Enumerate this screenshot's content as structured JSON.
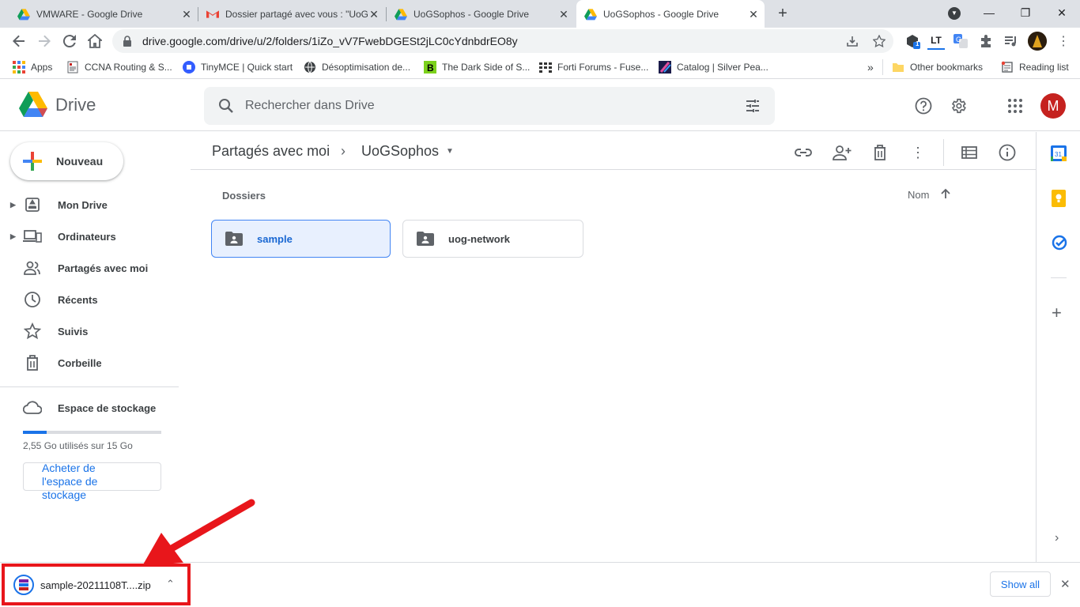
{
  "browser": {
    "tabs": [
      {
        "title": "VMWARE - Google Drive",
        "icon": "google-drive-icon"
      },
      {
        "title": "Dossier partagé avec vous : \"UoG",
        "icon": "gmail-icon"
      },
      {
        "title": "UoGSophos - Google Drive",
        "icon": "google-drive-icon"
      },
      {
        "title": "UoGSophos - Google Drive",
        "icon": "google-drive-icon",
        "active": true
      }
    ],
    "url": "drive.google.com/drive/u/2/folders/1iZo_vV7FwebDGESt2jLC0cYdnbdrEO8y",
    "bookmarks": [
      {
        "label": "Apps",
        "icon": "apps-grid-icon"
      },
      {
        "label": "CCNA Routing & S...",
        "icon": "document-icon"
      },
      {
        "label": "TinyMCE | Quick start",
        "icon": "tinymce-icon"
      },
      {
        "label": "Désoptimisation de...",
        "icon": "globe-icon"
      },
      {
        "label": "The Dark Side of S...",
        "icon": "bookmark-b-icon"
      },
      {
        "label": "Forti Forums - Fuse...",
        "icon": "forti-icon"
      },
      {
        "label": "Catalog | Silver Pea...",
        "icon": "catalog-icon"
      }
    ],
    "other_bookmarks": "Other bookmarks",
    "reading_list": "Reading list",
    "more_bookmarks": "»",
    "extension_badge": "1",
    "lt_label": "LT"
  },
  "drive": {
    "product_name": "Drive",
    "search_placeholder": "Rechercher dans Drive",
    "avatar_letter": "M",
    "new_button": "Nouveau",
    "nav": [
      {
        "label": "Mon Drive",
        "icon": "my-drive-icon",
        "expandable": true
      },
      {
        "label": "Ordinateurs",
        "icon": "computers-icon",
        "expandable": true
      },
      {
        "label": "Partagés avec moi",
        "icon": "shared-people-icon",
        "expandable": false
      },
      {
        "label": "Récents",
        "icon": "clock-icon",
        "expandable": false
      },
      {
        "label": "Suivis",
        "icon": "star-icon",
        "expandable": false
      },
      {
        "label": "Corbeille",
        "icon": "trash-icon",
        "expandable": false
      }
    ],
    "storage": {
      "label": "Espace de stockage",
      "used_text": "2,55 Go utilisés sur 15 Go",
      "used_fraction": 0.17,
      "buy_button": "Acheter de l'espace de stockage"
    },
    "breadcrumb": {
      "parent": "Partagés avec moi",
      "separator": "›",
      "current": "UoGSophos"
    },
    "section_title": "Dossiers",
    "sort_label": "Nom",
    "folders": [
      {
        "name": "sample",
        "selected": true
      },
      {
        "name": "uog-network",
        "selected": false
      }
    ]
  },
  "download": {
    "filename": "sample-20211108T....zip",
    "show_all": "Show all"
  },
  "colors": {
    "accent": "#1a73e8",
    "highlight_box": "#e8161b",
    "avatar": "#c5221f"
  }
}
